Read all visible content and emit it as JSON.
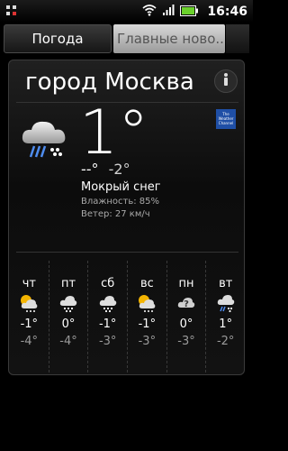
{
  "status_bar": {
    "time": "16:46"
  },
  "tabs": [
    {
      "label": "Погода",
      "active": true
    },
    {
      "label": "Главные ново...",
      "active": false
    }
  ],
  "weather": {
    "city": "город Москва",
    "current_temp": "1°",
    "high": "--°",
    "low": "-2°",
    "condition": "Мокрый снег",
    "humidity": "Влажность: 85%",
    "wind": "Ветер: 27 км/ч",
    "provider_logo_text": "The Weather Channel"
  },
  "forecast": [
    {
      "day": "чт",
      "hi": "-1°",
      "lo": "-4°",
      "icon": "partly-cloudy-snow-icon"
    },
    {
      "day": "пт",
      "hi": "0°",
      "lo": "-4°",
      "icon": "cloud-snow-icon"
    },
    {
      "day": "сб",
      "hi": "-1°",
      "lo": "-3°",
      "icon": "cloud-snow-icon"
    },
    {
      "day": "вс",
      "hi": "-1°",
      "lo": "-3°",
      "icon": "partly-cloudy-snow-icon"
    },
    {
      "day": "пн",
      "hi": "0°",
      "lo": "-3°",
      "icon": "cloud-unknown-icon"
    },
    {
      "day": "вт",
      "hi": "1°",
      "lo": "-2°",
      "icon": "cloud-sleet-icon"
    }
  ],
  "colors": {
    "accent_snow": "#5aa0ff",
    "sun": "#f4b400"
  }
}
